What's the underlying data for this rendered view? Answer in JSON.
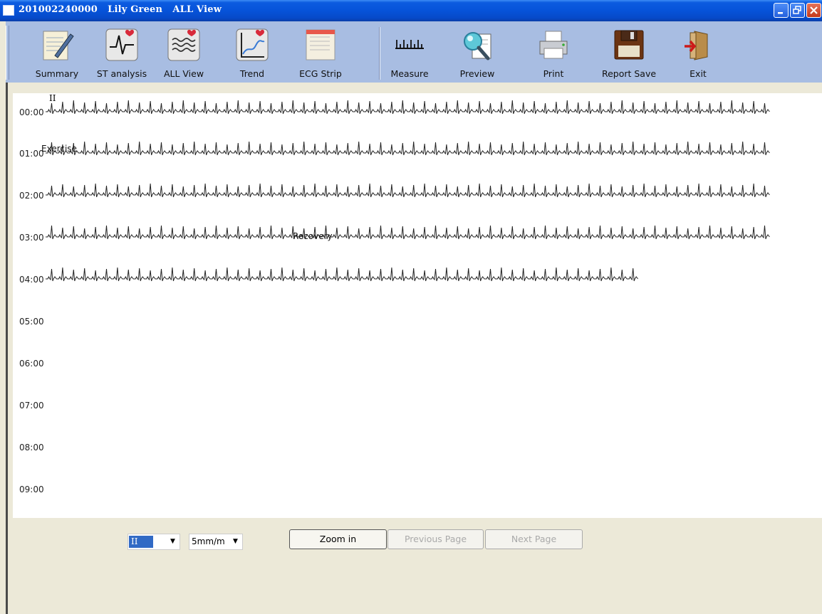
{
  "window": {
    "title": "201002240000   Lily Green   ALL View"
  },
  "toolbar": {
    "buttons": [
      {
        "label": "Summary",
        "icon": "summary-notepad-icon"
      },
      {
        "label": "ST analysis",
        "icon": "st-analysis-icon"
      },
      {
        "label": "ALL View",
        "icon": "all-view-icon"
      },
      {
        "label": "Trend",
        "icon": "trend-chart-icon"
      },
      {
        "label": "ECG Strip",
        "icon": "ecg-strip-icon"
      },
      {
        "label": "Measure",
        "icon": "ruler-icon"
      },
      {
        "label": "Preview",
        "icon": "magnifier-icon"
      },
      {
        "label": "Print",
        "icon": "printer-icon"
      },
      {
        "label": "Report Save",
        "icon": "floppy-disk-icon"
      },
      {
        "label": "Exit",
        "icon": "exit-door-icon"
      }
    ]
  },
  "ecg": {
    "lead": "II",
    "rows": [
      {
        "time": "00:00",
        "complete": true
      },
      {
        "time": "01:00",
        "complete": true
      },
      {
        "time": "02:00",
        "complete": true
      },
      {
        "time": "03:00",
        "complete": true
      },
      {
        "time": "04:00",
        "complete": false
      },
      {
        "time": "05:00",
        "complete": false
      },
      {
        "time": "06:00",
        "complete": false
      },
      {
        "time": "07:00",
        "complete": false
      },
      {
        "time": "08:00",
        "complete": false
      },
      {
        "time": "09:00",
        "complete": false
      }
    ],
    "markers": {
      "exercise": "Exercise",
      "recovery": "Recovery"
    }
  },
  "controls": {
    "lead_select": "II",
    "speed_select": "5mm/m",
    "zoom_in": "Zoom in",
    "previous_page": "Previous Page",
    "next_page": "Next Page"
  },
  "colors": {
    "titlebar": "#0653d9",
    "toolbar": "#a8bde2",
    "background": "#ece9d8",
    "trace": "#222222"
  }
}
